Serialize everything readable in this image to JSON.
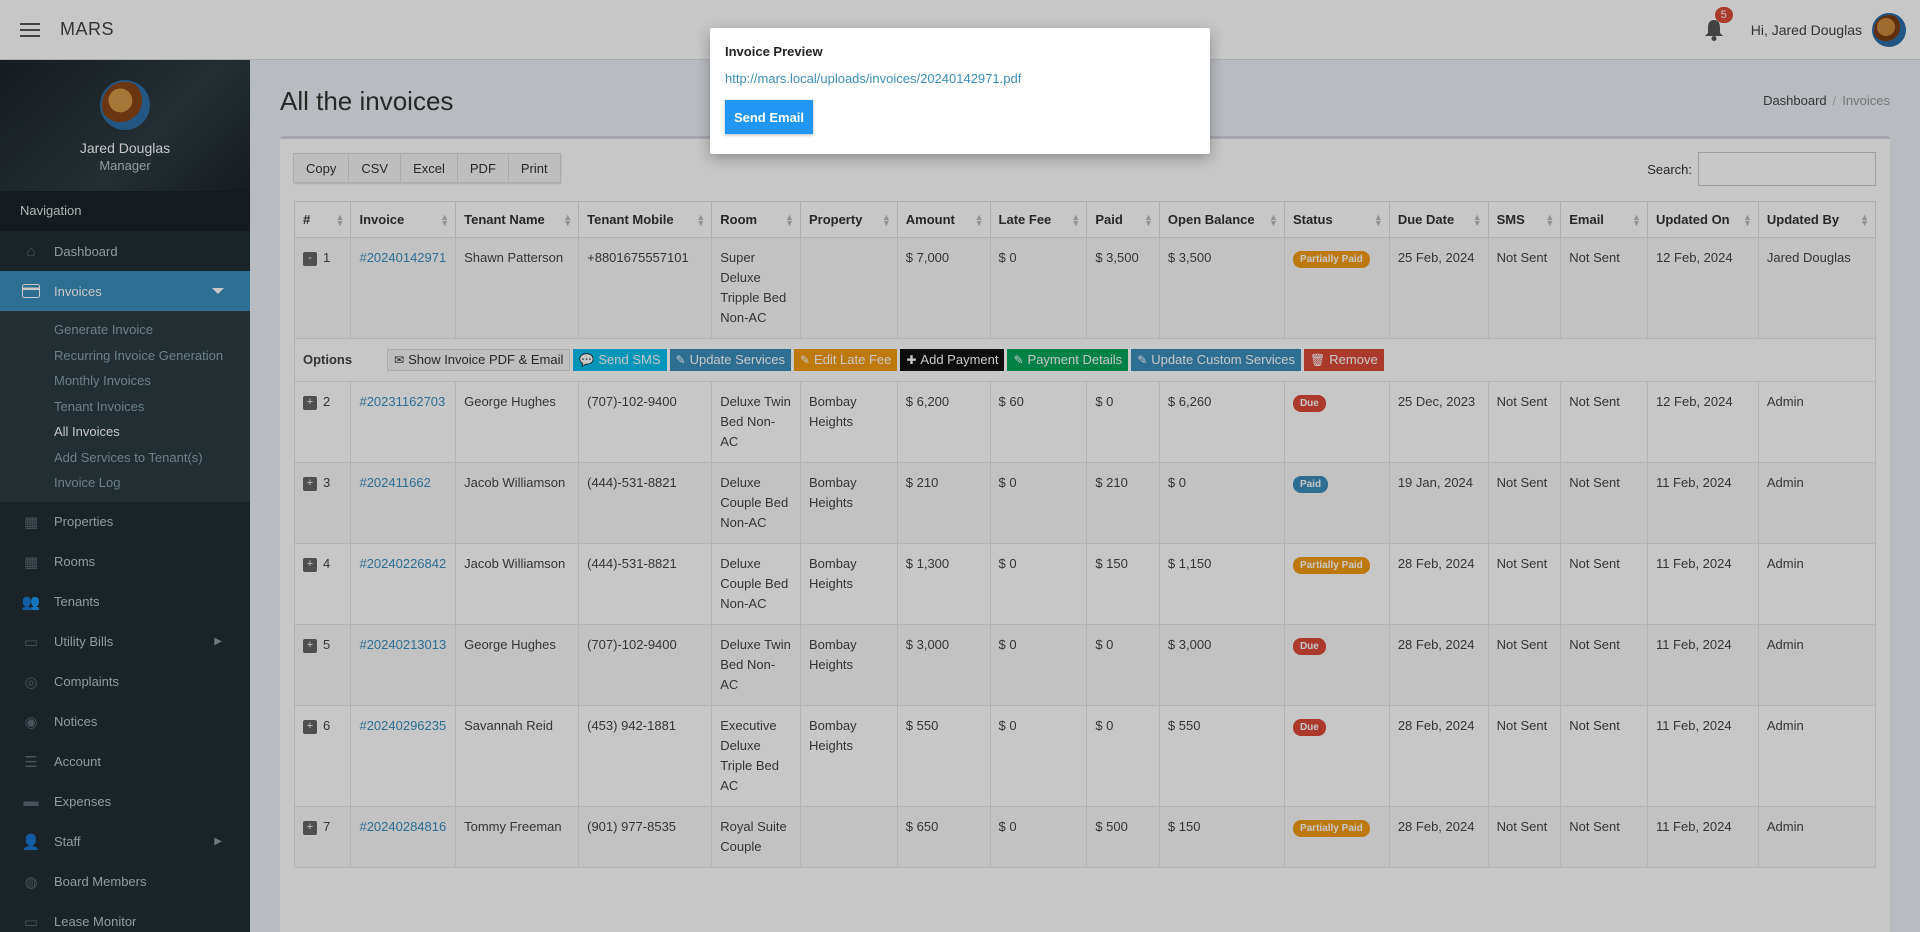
{
  "app": {
    "brand": "MARS"
  },
  "topbar": {
    "notifications": "5",
    "greeting": "Hi, Jared Douglas"
  },
  "user": {
    "name": "Jared Douglas",
    "role": "Manager"
  },
  "sidebar": {
    "header": "Navigation",
    "dashboard": "Dashboard",
    "invoices": "Invoices",
    "submenu": [
      "Generate Invoice",
      "Recurring Invoice Generation",
      "Monthly Invoices",
      "Tenant Invoices",
      "All Invoices",
      "Add Services to Tenant(s)",
      "Invoice Log"
    ],
    "items": [
      "Properties",
      "Rooms",
      "Tenants",
      "Utility Bills",
      "Complaints",
      "Notices",
      "Account",
      "Expenses",
      "Staff",
      "Board Members",
      "Lease Monitor"
    ]
  },
  "page": {
    "title": "All the invoices",
    "breadcrumb_home": "Dashboard",
    "breadcrumb_current": "Invoices"
  },
  "toolbar": {
    "buttons": [
      "Copy",
      "CSV",
      "Excel",
      "PDF",
      "Print"
    ],
    "search_label": "Search:"
  },
  "table": {
    "headers": [
      "#",
      "Invoice",
      "Tenant Name",
      "Tenant Mobile",
      "Room",
      "Property",
      "Amount",
      "Late Fee",
      "Paid",
      "Open Balance",
      "Status",
      "Due Date",
      "SMS",
      "Email",
      "Updated On",
      "Updated By"
    ],
    "rows": [
      {
        "num": "1",
        "toggle": "-",
        "invoice": "#20240142971",
        "tenant": "Shawn Patterson",
        "mobile": "+8801675557101",
        "room": "Super Deluxe Tripple Bed Non-AC",
        "property": "",
        "amount": "$ 7,000",
        "late_fee": "$ 0",
        "paid": "$ 3,500",
        "balance": "$ 3,500",
        "status": "Partially Paid",
        "status_type": "partial",
        "due": "25 Feb, 2024",
        "sms": "Not Sent",
        "email": "Not Sent",
        "updated_on": "12 Feb, 2024",
        "updated_by": "Jared Douglas"
      },
      {
        "num": "2",
        "toggle": "+",
        "invoice": "#20231162703",
        "tenant": "George Hughes",
        "mobile": "(707)-102-9400",
        "room": "Deluxe Twin Bed Non-AC",
        "property": "Bombay Heights",
        "amount": "$ 6,200",
        "late_fee": "$ 60",
        "paid": "$ 0",
        "balance": "$ 6,260",
        "status": "Due",
        "status_type": "due",
        "due": "25 Dec, 2023",
        "sms": "Not Sent",
        "email": "Not Sent",
        "updated_on": "12 Feb, 2024",
        "updated_by": "Admin"
      },
      {
        "num": "3",
        "toggle": "+",
        "invoice": "#202411662",
        "tenant": "Jacob Williamson",
        "mobile": "(444)-531-8821",
        "room": "Deluxe Couple Bed Non-AC",
        "property": "Bombay Heights",
        "amount": "$ 210",
        "late_fee": "$ 0",
        "paid": "$ 210",
        "balance": "$ 0",
        "status": "Paid",
        "status_type": "paid",
        "due": "19 Jan, 2024",
        "sms": "Not Sent",
        "email": "Not Sent",
        "updated_on": "11 Feb, 2024",
        "updated_by": "Admin"
      },
      {
        "num": "4",
        "toggle": "+",
        "invoice": "#20240226842",
        "tenant": "Jacob Williamson",
        "mobile": "(444)-531-8821",
        "room": "Deluxe Couple Bed Non-AC",
        "property": "Bombay Heights",
        "amount": "$ 1,300",
        "late_fee": "$ 0",
        "paid": "$ 150",
        "balance": "$ 1,150",
        "status": "Partially Paid",
        "status_type": "partial",
        "due": "28 Feb, 2024",
        "sms": "Not Sent",
        "email": "Not Sent",
        "updated_on": "11 Feb, 2024",
        "updated_by": "Admin"
      },
      {
        "num": "5",
        "toggle": "+",
        "invoice": "#20240213013",
        "tenant": "George Hughes",
        "mobile": "(707)-102-9400",
        "room": "Deluxe Twin Bed Non-AC",
        "property": "Bombay Heights",
        "amount": "$ 3,000",
        "late_fee": "$ 0",
        "paid": "$ 0",
        "balance": "$ 3,000",
        "status": "Due",
        "status_type": "due",
        "due": "28 Feb, 2024",
        "sms": "Not Sent",
        "email": "Not Sent",
        "updated_on": "11 Feb, 2024",
        "updated_by": "Admin"
      },
      {
        "num": "6",
        "toggle": "+",
        "invoice": "#20240296235",
        "tenant": "Savannah Reid",
        "mobile": "(453) 942-1881",
        "room": "Executive Deluxe Triple Bed AC",
        "property": "Bombay Heights",
        "amount": "$ 550",
        "late_fee": "$ 0",
        "paid": "$ 0",
        "balance": "$ 550",
        "status": "Due",
        "status_type": "due",
        "due": "28 Feb, 2024",
        "sms": "Not Sent",
        "email": "Not Sent",
        "updated_on": "11 Feb, 2024",
        "updated_by": "Admin"
      },
      {
        "num": "7",
        "toggle": "+",
        "invoice": "#20240284816",
        "tenant": "Tommy Freeman",
        "mobile": "(901) 977-8535",
        "room": "Royal Suite Couple",
        "property": "",
        "amount": "$ 650",
        "late_fee": "$ 0",
        "paid": "$ 500",
        "balance": "$ 150",
        "status": "Partially Paid",
        "status_type": "partial",
        "due": "28 Feb, 2024",
        "sms": "Not Sent",
        "email": "Not Sent",
        "updated_on": "11 Feb, 2024",
        "updated_by": "Admin"
      }
    ]
  },
  "options": {
    "label": "Options",
    "buttons": [
      {
        "label": "Show Invoice PDF & Email",
        "style": "ob-default",
        "icon": "envelope-icon",
        "glyph": "✉"
      },
      {
        "label": "Send SMS",
        "style": "ob-teal",
        "icon": "comment-icon",
        "glyph": "💬"
      },
      {
        "label": "Update Services",
        "style": "ob-blue",
        "icon": "edit-icon",
        "glyph": "✎"
      },
      {
        "label": "Edit Late Fee",
        "style": "ob-orange",
        "icon": "edit-icon",
        "glyph": "✎"
      },
      {
        "label": "Add Payment",
        "style": "ob-black",
        "icon": "plus-icon",
        "glyph": "✚"
      },
      {
        "label": "Payment Details",
        "style": "ob-green",
        "icon": "edit-icon",
        "glyph": "✎"
      },
      {
        "label": "Update Custom Services",
        "style": "ob-blue",
        "icon": "edit-icon",
        "glyph": "✎"
      },
      {
        "label": "Remove",
        "style": "ob-red",
        "icon": "trash-icon",
        "glyph": "🗑"
      }
    ]
  },
  "modal": {
    "title": "Invoice Preview",
    "link": "http://mars.local/uploads/invoices/20240142971.pdf",
    "button": "Send Email"
  }
}
